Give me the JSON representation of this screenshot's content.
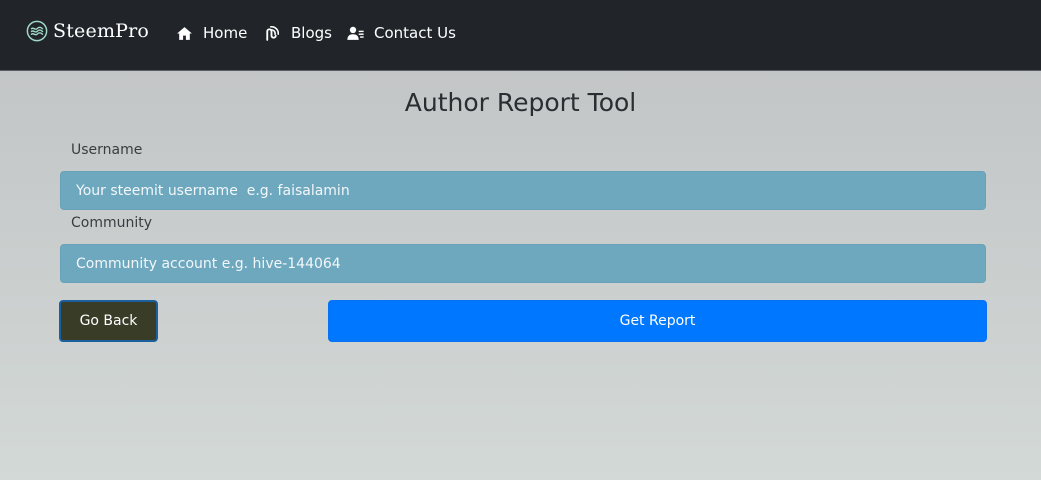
{
  "navbar": {
    "brand": "SteemPro",
    "brand_icon": "steem-logo-icon",
    "items": [
      {
        "label": "Home",
        "icon": "home-icon"
      },
      {
        "label": "Blogs",
        "icon": "blog-icon"
      },
      {
        "label": "Contact Us",
        "icon": "contact-icon"
      }
    ]
  },
  "page": {
    "title": "Author Report Tool"
  },
  "form": {
    "username": {
      "label": "Username",
      "placeholder": "Your steemit username  e.g. faisalamin",
      "value": ""
    },
    "community": {
      "label": "Community",
      "placeholder": "Community account e.g. hive-144064",
      "value": ""
    },
    "back_label": "Go Back",
    "submit_label": "Get Report"
  },
  "colors": {
    "navbar_bg": "#212529",
    "input_bg": "#6ea8be",
    "primary": "#0077ff",
    "back_button_bg": "#393d28"
  }
}
